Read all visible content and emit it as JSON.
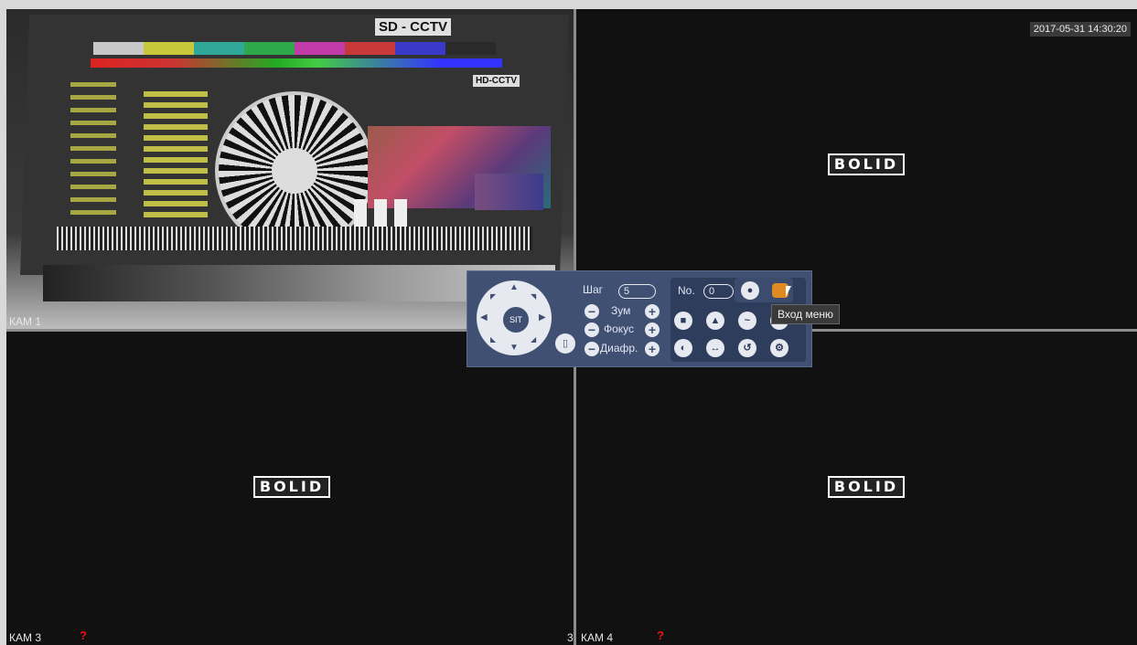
{
  "cameras": {
    "cam1": {
      "label": "КАМ 1"
    },
    "cam2": {
      "datetime": "2017-05-31 14:30:20",
      "logo": "BOLID"
    },
    "cam3": {
      "label": "КАМ 3",
      "status": "?",
      "logo": "BOLID"
    },
    "cam4": {
      "label": "КАМ 4",
      "num": "3",
      "status": "?",
      "logo": "BOLID"
    }
  },
  "test_chart": {
    "sd_label": "SD - CCTV",
    "hd_label": "HD-CCTV"
  },
  "ptz": {
    "center_label": "SIT",
    "step_label": "Шаг",
    "step_value": "5",
    "zoom_label": "Зум",
    "focus_label": "Фокус",
    "iris_label": "Диафр.",
    "preset_label": "No.",
    "preset_value": "0",
    "minus": "−",
    "plus": "+",
    "icons": [
      "light-icon",
      "menu-icon",
      "camera-icon",
      "pattern-icon",
      "tour-icon",
      "scan-icon",
      "pan-icon",
      "flip-icon",
      "reset-icon",
      "settings-icon"
    ]
  },
  "tooltip": {
    "text": "Вход меню"
  },
  "colors": {
    "panel": "#405072",
    "panel_dark": "#2f3d5c",
    "accent": "#e08a22"
  }
}
